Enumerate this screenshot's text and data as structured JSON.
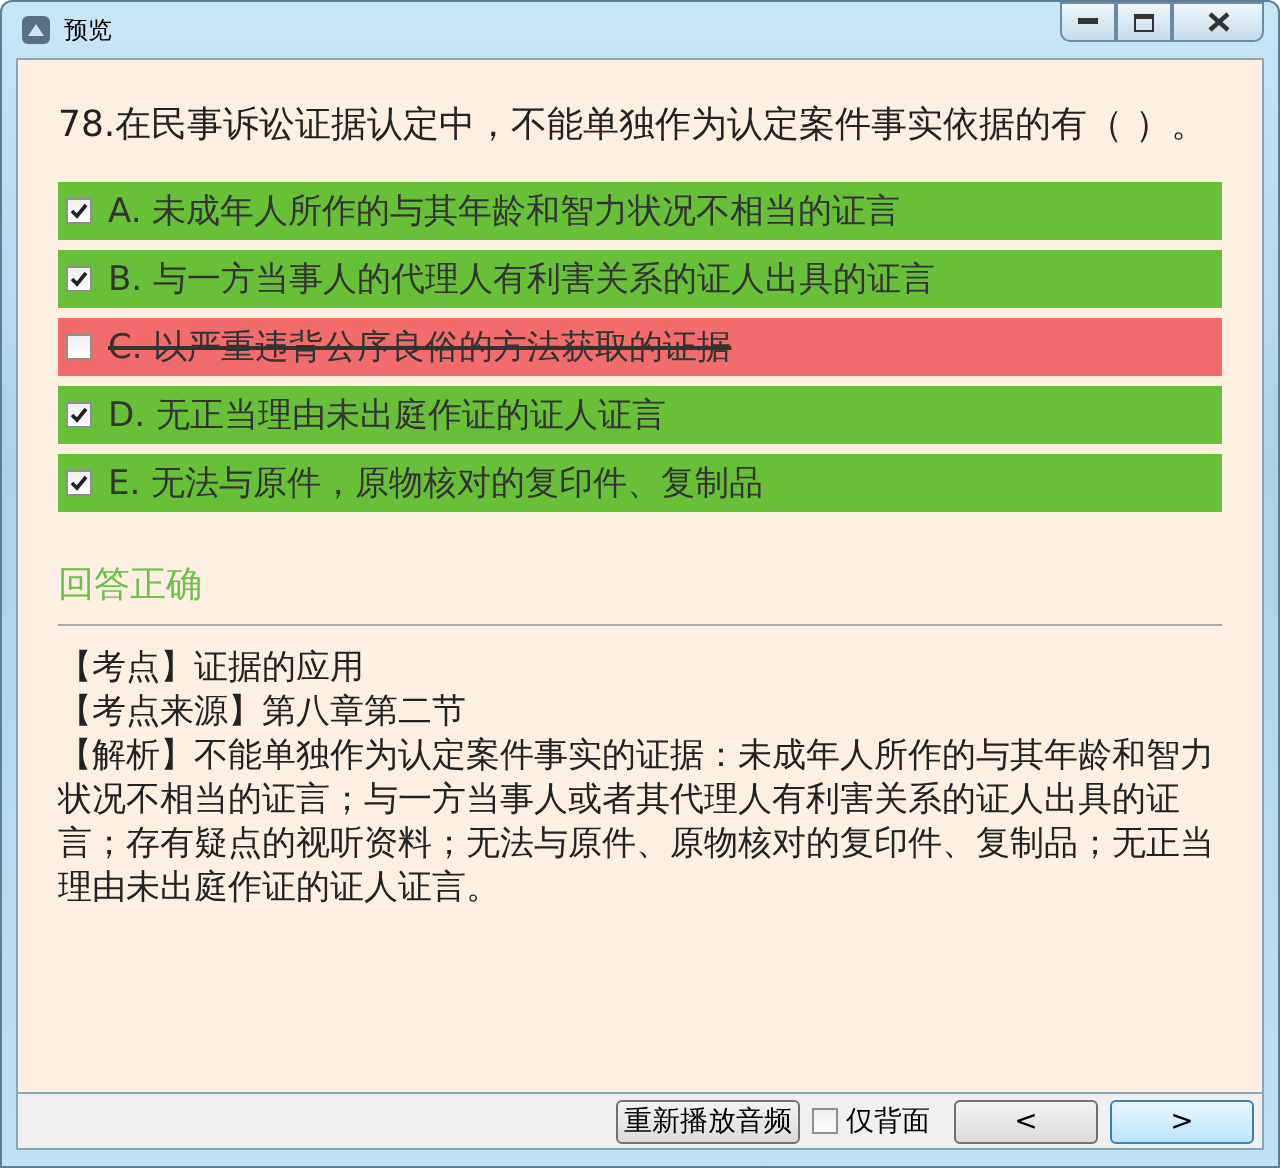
{
  "window": {
    "title": "预览"
  },
  "question": "78.在民事诉讼证据认定中，不能单独作为认定案件事实依据的有（  ）。",
  "options": [
    {
      "label": "A. 未成年人所作的与其年龄和智力状况不相当的证言",
      "checked": true,
      "correct": true
    },
    {
      "label": "B. 与一方当事人的代理人有利害关系的证人出具的证言",
      "checked": true,
      "correct": true
    },
    {
      "label": "C. 以严重违背公序良俗的方法获取的证据",
      "checked": false,
      "correct": false
    },
    {
      "label": "D. 无正当理由未出庭作证的证人证言",
      "checked": true,
      "correct": true
    },
    {
      "label": "E. 无法与原件，原物核对的复印件、复制品",
      "checked": true,
      "correct": true
    }
  ],
  "result": "回答正确",
  "explanation": [
    "【考点】证据的应用",
    "【考点来源】第八章第二节",
    "【解析】不能单独作为认定案件事实的证据：未成年人所作的与其年龄和智力状况不相当的证言；与一方当事人或者其代理人有利害关系的证人出具的证言；存有疑点的视听资料；无法与原件、原物核对的复印件、复制品；无正当理由未出庭作证的证人证言。"
  ],
  "footer": {
    "replay_button": "重新播放音频",
    "back_only": {
      "label": "仅背面",
      "checked": false
    },
    "prev_button": "<",
    "next_button": ">"
  }
}
